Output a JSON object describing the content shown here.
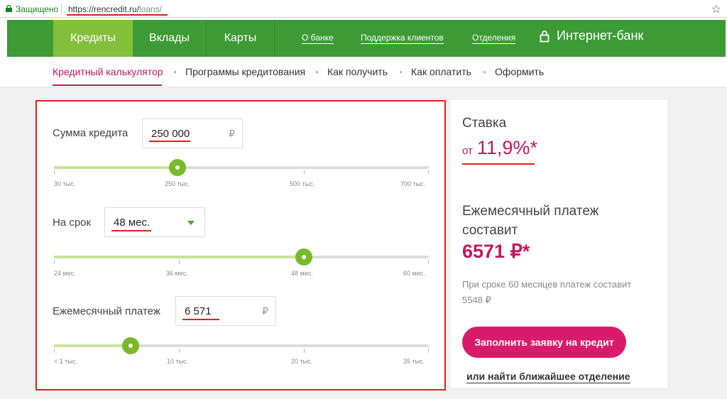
{
  "browser": {
    "secure_label": "Защищено",
    "url_host": "https://rencredit.ru/",
    "url_path": "loans/"
  },
  "nav": {
    "items": [
      {
        "label": "Кредиты"
      },
      {
        "label": "Вклады"
      },
      {
        "label": "Карты"
      }
    ],
    "links": [
      {
        "label": "О банке"
      },
      {
        "label": "Поддержка клиентов"
      },
      {
        "label": "Отделения"
      }
    ],
    "internet_bank": "Интернет-банк"
  },
  "subnav": {
    "items": [
      {
        "label": "Кредитный калькулятор"
      },
      {
        "label": "Программы кредитования"
      },
      {
        "label": "Как получить"
      },
      {
        "label": "Как оплатить"
      },
      {
        "label": "Оформить"
      }
    ]
  },
  "calculator": {
    "amount": {
      "label": "Сумма кредита",
      "value": "250 000",
      "currency": "₽",
      "scale": [
        "30 тыс.",
        "250 тыс.",
        "500 тыс.",
        "700 тыс."
      ],
      "slider_fraction": 0.33
    },
    "term": {
      "label": "На срок",
      "value": "48 мес.",
      "scale": [
        "24 мес.",
        "36 мес.",
        "48 мес.",
        "60 мес."
      ],
      "slider_fraction": 0.667
    },
    "payment": {
      "label": "Ежемесячный платеж",
      "value": "6 571",
      "currency": "₽",
      "scale": [
        "< 1 тыс.",
        "10 тыс.",
        "20 тыс.",
        "35 тыс."
      ],
      "slider_fraction": 0.205
    }
  },
  "result": {
    "rate_title": "Ставка",
    "rate_prefix": "от",
    "rate_value": "11,9%*",
    "payment_title_1": "Ежемесячный платеж",
    "payment_title_2": "составит",
    "payment_value": "6571 ₽*",
    "note": "При сроке 60 месяцев платеж составит 5548 ₽",
    "apply_button": "Заполнить заявку на кредит",
    "branch_link": "или найти ближайшее отделение"
  },
  "colors": {
    "brand_green": "#3d9b35",
    "active_green": "#83bf3a",
    "accent_pink": "#c2185b",
    "highlight_red": "#e01e1e"
  }
}
